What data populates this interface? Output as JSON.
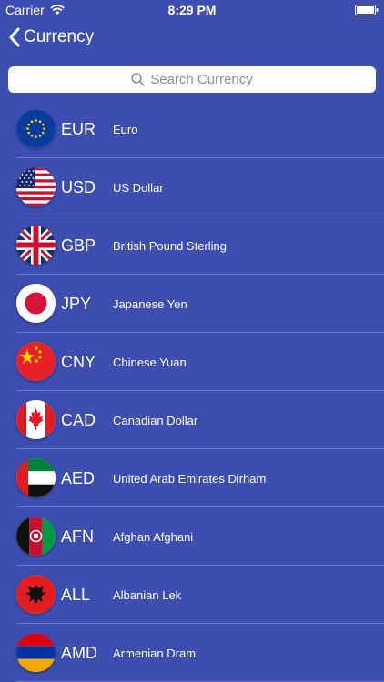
{
  "status": {
    "carrier": "Carrier",
    "time": "8:29 PM"
  },
  "nav": {
    "back_label": "Currency"
  },
  "search": {
    "placeholder": "Search Currency"
  },
  "currencies": [
    {
      "code": "EUR",
      "name": "Euro",
      "flag": "eu-flag-icon"
    },
    {
      "code": "USD",
      "name": "US Dollar",
      "flag": "us-flag-icon"
    },
    {
      "code": "GBP",
      "name": "British Pound Sterling",
      "flag": "gb-flag-icon"
    },
    {
      "code": "JPY",
      "name": "Japanese Yen",
      "flag": "jp-flag-icon"
    },
    {
      "code": "CNY",
      "name": "Chinese Yuan",
      "flag": "cn-flag-icon"
    },
    {
      "code": "CAD",
      "name": "Canadian Dollar",
      "flag": "ca-flag-icon"
    },
    {
      "code": "AED",
      "name": "United Arab Emirates Dirham",
      "flag": "ae-flag-icon"
    },
    {
      "code": "AFN",
      "name": "Afghan Afghani",
      "flag": "af-flag-icon"
    },
    {
      "code": "ALL",
      "name": "Albanian Lek",
      "flag": "al-flag-icon"
    },
    {
      "code": "AMD",
      "name": "Armenian Dram",
      "flag": "am-flag-icon"
    }
  ],
  "colors": {
    "background": "#3c4eb0",
    "text": "#ffffff",
    "search_placeholder": "#8e8e93"
  }
}
